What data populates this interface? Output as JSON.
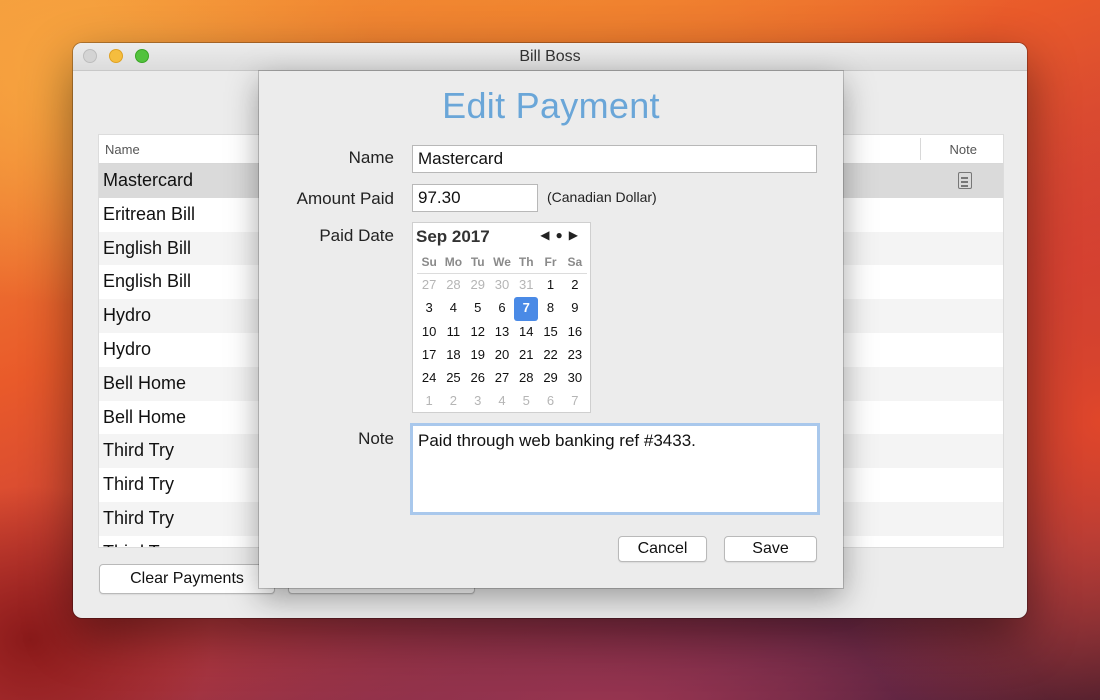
{
  "window": {
    "title": "Bill Boss"
  },
  "table": {
    "headers": {
      "name": "Name",
      "note": "Note"
    },
    "rows": [
      {
        "name": "Mastercard",
        "has_note": true,
        "selected": true
      },
      {
        "name": "Eritrean Bill"
      },
      {
        "name": "English Bill"
      },
      {
        "name": "English Bill"
      },
      {
        "name": "Hydro"
      },
      {
        "name": "Hydro"
      },
      {
        "name": "Bell Home"
      },
      {
        "name": "Bell Home"
      },
      {
        "name": "Third Try"
      },
      {
        "name": "Third Try"
      },
      {
        "name": "Third Try"
      },
      {
        "name": "Third Try"
      }
    ]
  },
  "footer": {
    "clear_label": "Clear Payments"
  },
  "sheet": {
    "title": "Edit Payment",
    "name_label": "Name",
    "name_value": "Mastercard",
    "amount_label": "Amount Paid",
    "amount_value": "97.30",
    "currency": "(Canadian Dollar)",
    "date_label": "Paid Date",
    "note_label": "Note",
    "note_value": "Paid through web banking ref #3433.",
    "cancel_label": "Cancel",
    "save_label": "Save"
  },
  "calendar": {
    "month_label": "Sep 2017",
    "nav": {
      "prev": "◀",
      "today": "●",
      "next": "▶"
    },
    "weekdays": [
      "Su",
      "Mo",
      "Tu",
      "We",
      "Th",
      "Fr",
      "Sa"
    ],
    "weeks": [
      [
        {
          "d": "27",
          "dim": true
        },
        {
          "d": "28",
          "dim": true
        },
        {
          "d": "29",
          "dim": true
        },
        {
          "d": "30",
          "dim": true
        },
        {
          "d": "31",
          "dim": true
        },
        {
          "d": "1"
        },
        {
          "d": "2"
        }
      ],
      [
        {
          "d": "3"
        },
        {
          "d": "4"
        },
        {
          "d": "5"
        },
        {
          "d": "6"
        },
        {
          "d": "7",
          "selected": true
        },
        {
          "d": "8"
        },
        {
          "d": "9"
        }
      ],
      [
        {
          "d": "10"
        },
        {
          "d": "11"
        },
        {
          "d": "12"
        },
        {
          "d": "13"
        },
        {
          "d": "14"
        },
        {
          "d": "15"
        },
        {
          "d": "16"
        }
      ],
      [
        {
          "d": "17"
        },
        {
          "d": "18"
        },
        {
          "d": "19"
        },
        {
          "d": "20"
        },
        {
          "d": "21"
        },
        {
          "d": "22"
        },
        {
          "d": "23"
        }
      ],
      [
        {
          "d": "24"
        },
        {
          "d": "25"
        },
        {
          "d": "26"
        },
        {
          "d": "27"
        },
        {
          "d": "28"
        },
        {
          "d": "29"
        },
        {
          "d": "30"
        }
      ],
      [
        {
          "d": "1",
          "dim": true
        },
        {
          "d": "2",
          "dim": true
        },
        {
          "d": "3",
          "dim": true
        },
        {
          "d": "4",
          "dim": true
        },
        {
          "d": "5",
          "dim": true
        },
        {
          "d": "6",
          "dim": true
        },
        {
          "d": "7",
          "dim": true
        }
      ]
    ]
  }
}
